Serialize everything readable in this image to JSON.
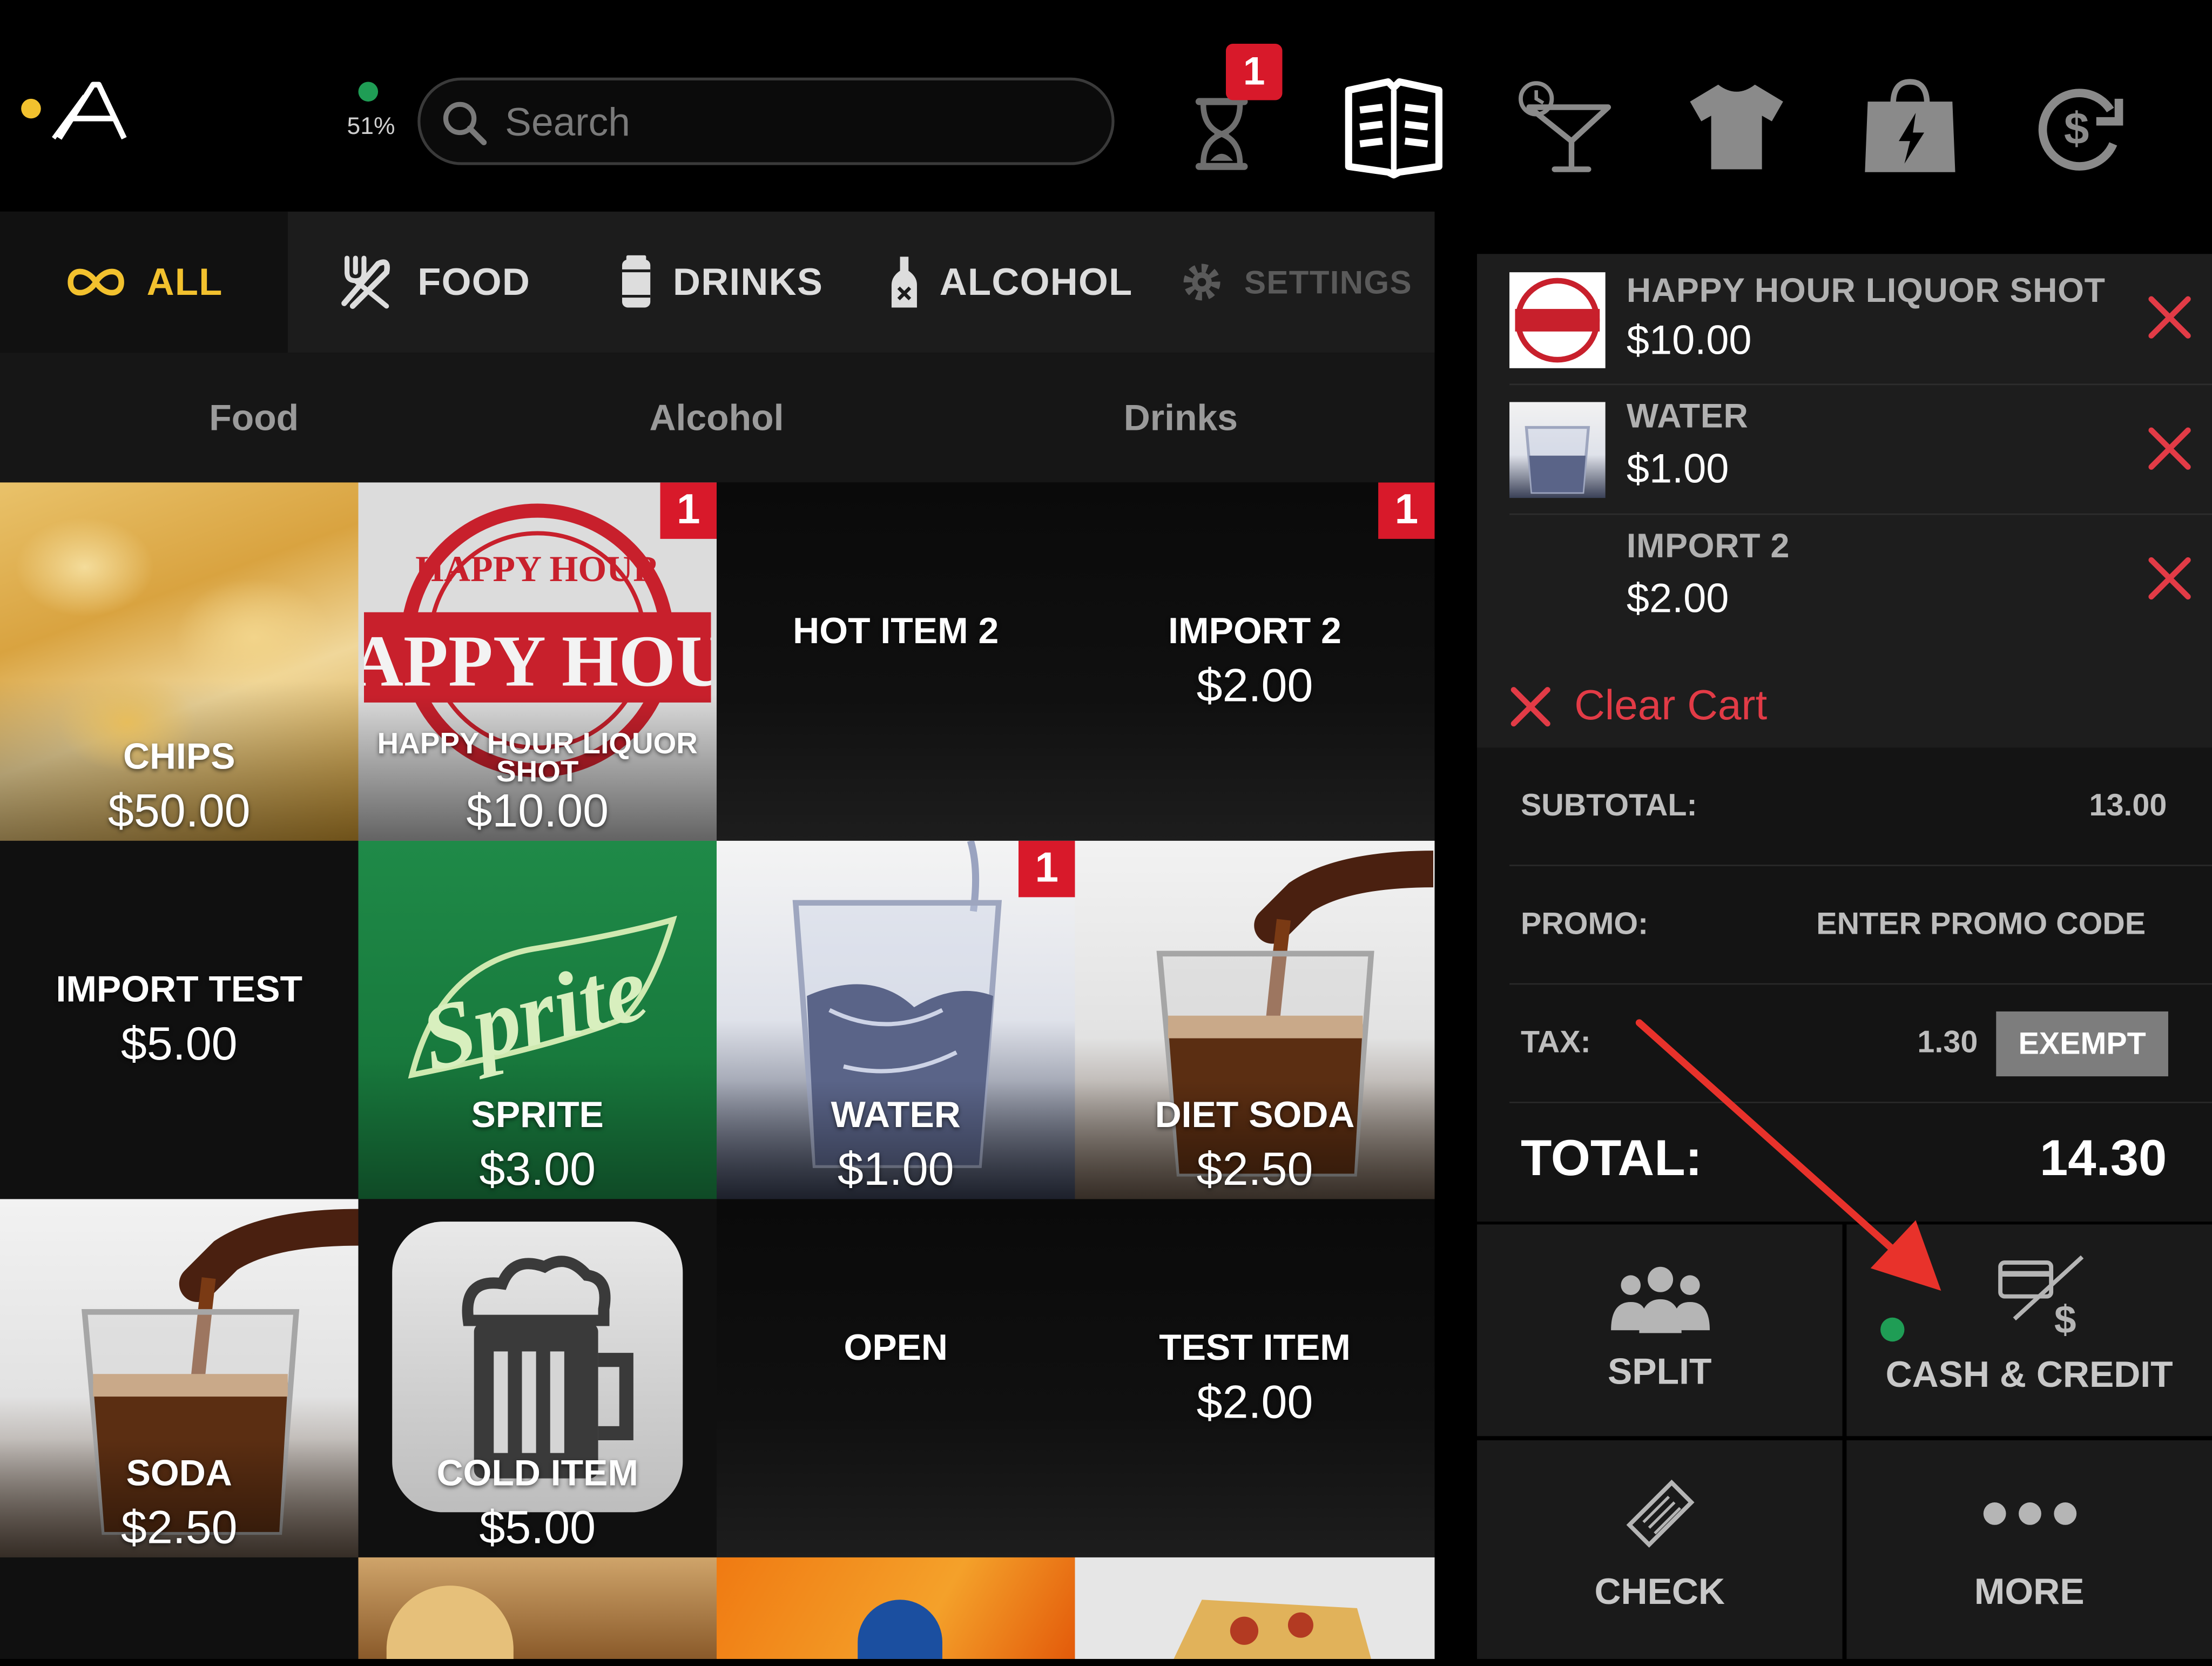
{
  "header": {
    "battery": "51%",
    "search_placeholder": "Search",
    "pending_badge": "1"
  },
  "categories": [
    {
      "label": "ALL"
    },
    {
      "label": "FOOD"
    },
    {
      "label": "DRINKS"
    },
    {
      "label": "ALCOHOL"
    },
    {
      "label": "SETTINGS"
    }
  ],
  "subcategories": [
    "Food",
    "Alcohol",
    "Drinks"
  ],
  "items": [
    {
      "name": "CHIPS",
      "price": "$50.00"
    },
    {
      "name": "HAPPY HOUR LIQUOR SHOT",
      "price": "$10.00",
      "badge": "1"
    },
    {
      "name": "HOT ITEM 2",
      "price": ""
    },
    {
      "name": "IMPORT 2",
      "price": "$2.00",
      "badge": "1"
    },
    {
      "name": "IMPORT TEST",
      "price": "$5.00"
    },
    {
      "name": "SPRITE",
      "price": "$3.00",
      "logo": "Sprite"
    },
    {
      "name": "WATER",
      "price": "$1.00",
      "badge": "1"
    },
    {
      "name": "DIET SODA",
      "price": "$2.50"
    },
    {
      "name": "SODA",
      "price": "$2.50"
    },
    {
      "name": "COLD ITEM",
      "price": "$5.00"
    },
    {
      "name": "OPEN",
      "price": ""
    },
    {
      "name": "TEST ITEM",
      "price": "$2.00"
    }
  ],
  "happy_hour_logo": {
    "top": "HAPPY HOUR",
    "main": "HAPPY HOUR"
  },
  "cart": {
    "items": [
      {
        "name": "HAPPY HOUR LIQUOR SHOT",
        "price": "$10.00"
      },
      {
        "name": "WATER",
        "price": "$1.00"
      },
      {
        "name": "IMPORT 2",
        "price": "$2.00"
      }
    ],
    "clear_label": "Clear Cart"
  },
  "summary": {
    "subtotal_label": "SUBTOTAL:",
    "subtotal_value": "13.00",
    "promo_label": "PROMO:",
    "promo_placeholder": "ENTER PROMO CODE",
    "tax_label": "TAX:",
    "tax_value": "1.30",
    "exempt_label": "EXEMPT",
    "total_label": "TOTAL:",
    "total_value": "14.30"
  },
  "actions": {
    "split": "SPLIT",
    "cash_credit": "CASH & CREDIT",
    "check": "CHECK",
    "more": "MORE"
  },
  "colors": {
    "accent": "#f2c12e",
    "badge": "#d8192a",
    "remove": "#e23b46",
    "status_green": "#1f9d55"
  }
}
